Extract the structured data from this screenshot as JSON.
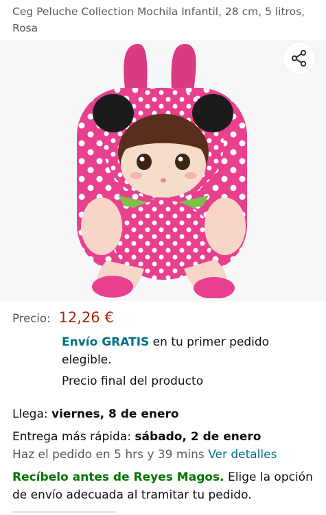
{
  "product": {
    "title": "Ceg Peluche Collection Mochila Infantil, 28 cm, 5 litros, Rosa"
  },
  "share": {
    "icon": "share-icon"
  },
  "price": {
    "label": "Precio:",
    "value": "12,26 €"
  },
  "shipping": {
    "free_label": "Envío GRATIS",
    "rest": " en tu primer pedido elegible."
  },
  "final_price_note": "Precio final del producto",
  "delivery": {
    "arrive_label": "Llega: ",
    "arrive_date": "viernes, 8 de enero",
    "fast_label": "Entrega más rápida: ",
    "fast_date": "sábado, 2 de enero",
    "order_by": "Haz el pedido en 5 hrs y 39 mins ",
    "details_link": "Ver detalles"
  },
  "promo": {
    "highlight": "Recíbelo antes de Reyes Magos.",
    "text": " Elige la opción de envío adecuada al tramitar tu pedido."
  },
  "colors": {
    "price": "#b12704",
    "link": "#007185",
    "promo": "#007600",
    "backpack_pink": "#e8408f"
  }
}
